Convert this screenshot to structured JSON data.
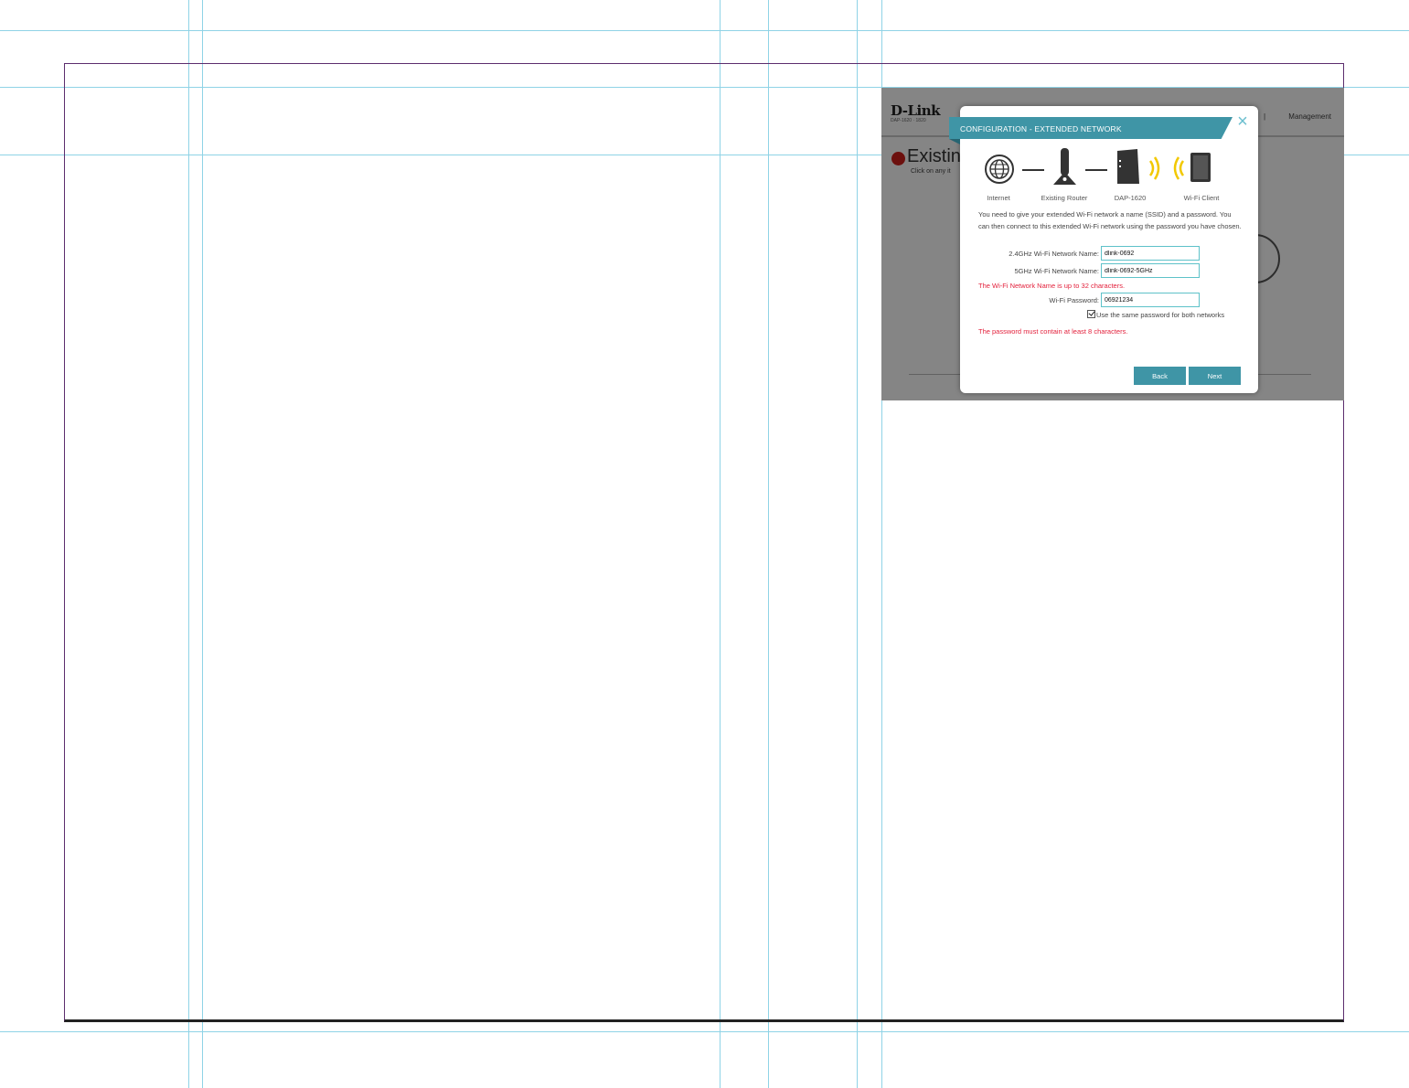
{
  "background_page": {
    "logo": "D-Link",
    "logo_tagline": "DAP-1620 · 1820",
    "nav_separator": "|",
    "nav_management": "Management",
    "section_title": "Existing",
    "section_subtitle": "Click on any it",
    "status_color": "#d0201b"
  },
  "modal": {
    "title": "CONFIGURATION - EXTENDED NETWORK",
    "close_icon": "close-x",
    "accent_color": "#3f95a6",
    "diagram": {
      "internet": "Internet",
      "router": "Existing Router",
      "extender": "DAP-1620",
      "client": "Wi-Fi Client"
    },
    "description": "You need to give your extended Wi-Fi network a name (SSID) and a password. You can then connect to this extended Wi-Fi network using the password you have chosen.",
    "fields": {
      "ssid_24_label": "2.4GHz Wi-Fi Network Name:",
      "ssid_24_value": "dlink-0692",
      "ssid_5_label": "5GHz Wi-Fi Network Name:",
      "ssid_5_value": "dlink-0692-5GHz",
      "ssid_warning": "The Wi-Fi Network Name is up to 32 characters.",
      "password_label": "Wi-Fi Password:",
      "password_value": "06921234",
      "same_password_label": "Use the same password for both networks",
      "same_password_checked": true,
      "password_warning": "The password must contain at least 8 characters."
    },
    "buttons": {
      "back": "Back",
      "next": "Next"
    }
  }
}
